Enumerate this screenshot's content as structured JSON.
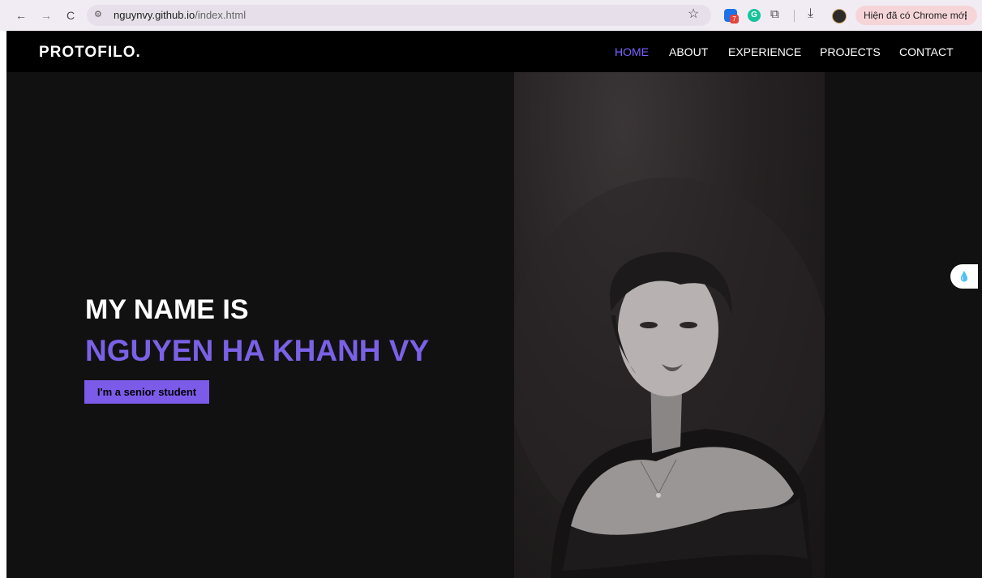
{
  "browser": {
    "nav": {
      "back": "←",
      "forward": "→",
      "reload": "C"
    },
    "site_info_icon": "site-info-icon",
    "url_host": "nguynvy.github.io",
    "url_path": "/index.html",
    "extension_badge": "7",
    "extension2_label": "G",
    "update_label": "Hiện đã có Chrome mới",
    "kebab": "⋮"
  },
  "site": {
    "logo": "PROTOFILO.",
    "menu": [
      "HOME",
      "ABOUT",
      "EXPERIENCE",
      "PROJECTS",
      "CONTACT"
    ],
    "hero": {
      "line1": "MY NAME IS",
      "line2": "NGUYEN HA KHANH VY",
      "button": "I'm a senior student"
    }
  },
  "colors": {
    "accent": "#7b61ff",
    "background": "#121112",
    "nav_bg": "#000000",
    "button_bg": "#7b5be8"
  }
}
